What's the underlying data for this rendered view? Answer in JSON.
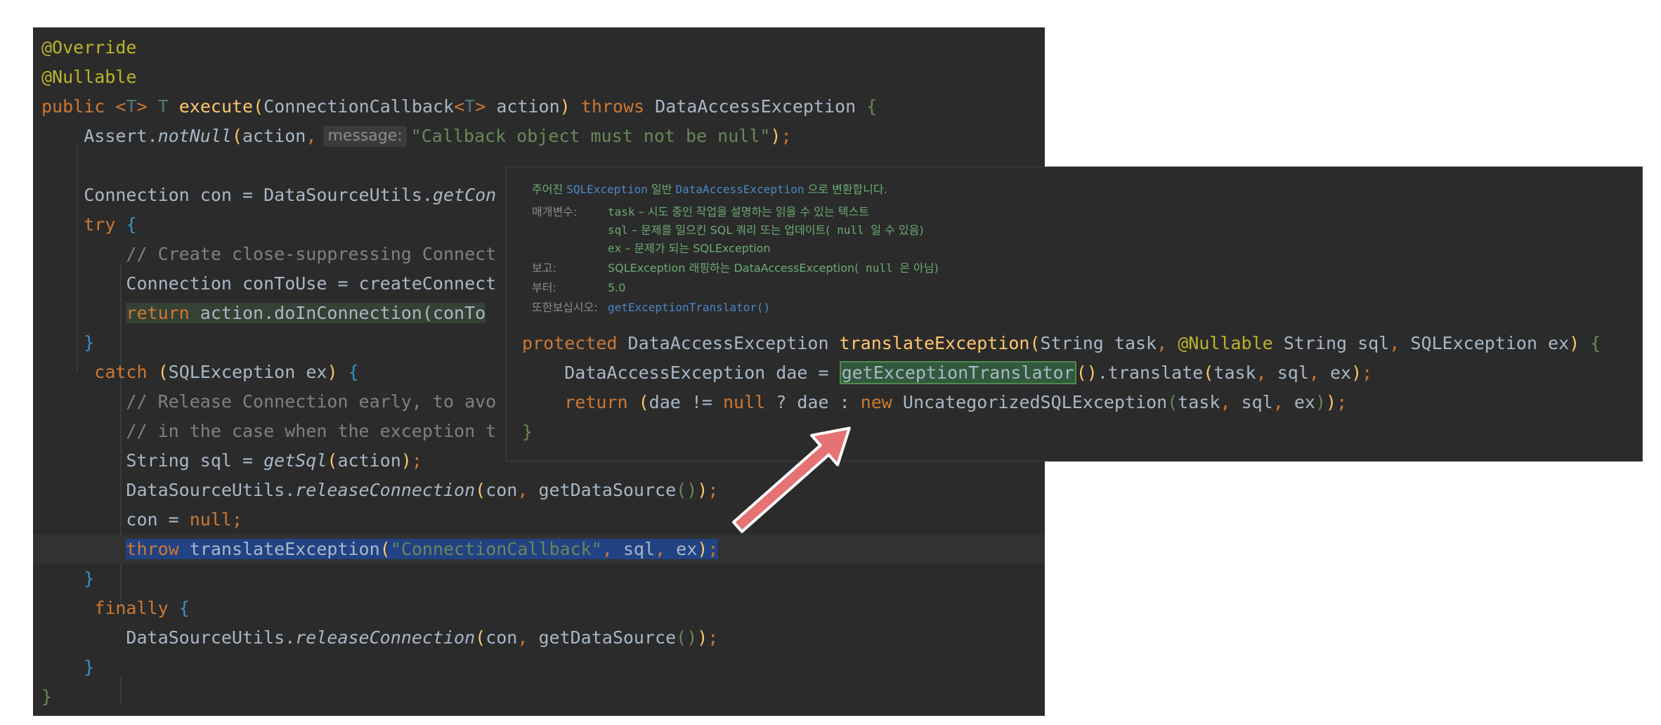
{
  "editor": {
    "override": "@Override",
    "nullable": "@Nullable",
    "sig": {
      "public": "public",
      "lt": "<",
      "T1": "T",
      "gt": ">",
      "T2": "T",
      "name": "execute",
      "open": "(",
      "type": "ConnectionCallback",
      "lt2": "<",
      "T3": "T",
      "gt2": ">",
      "param": " action",
      "close": ")",
      "throws": "throws",
      "exc": "DataAccessException",
      "brace": "{"
    },
    "l4": {
      "cls": "Assert.",
      "method": "notNull",
      "open": "(",
      "arg": "action",
      "comma": ",",
      "hint": "message:",
      "str": "\"Callback object must not be null\"",
      "close": ")",
      "semi": ";"
    },
    "l6": {
      "pre": "Connection con = DataSourceUtils.",
      "method": "getCon"
    },
    "l7": {
      "kw": "try",
      "brace": "{"
    },
    "l8": {
      "comment": "// Create close-suppressing Connect"
    },
    "l9": {
      "text": "Connection conToUse = createConnect"
    },
    "l10": {
      "kw": "return",
      "text": " action.doInConnection(conTo"
    },
    "l11": {
      "brace": "}"
    },
    "l12": {
      "kw": "catch",
      "open": "(",
      "text": "SQLException ex",
      "close": ")",
      "brace": "{"
    },
    "l13": {
      "comment": "// Release Connection early, to avo"
    },
    "l14": {
      "comment": "// in the case when the exception t"
    },
    "l15": {
      "pre": "String sql = ",
      "method": "getSql",
      "open": "(",
      "arg": "action",
      "close": ")",
      "semi": ";"
    },
    "l16": {
      "pre": "DataSourceUtils.",
      "method": "releaseConnection",
      "open": "(",
      "arg": "con",
      "comma": ",",
      "call": "getDataSource",
      "inner": "()",
      "close": ")",
      "semi": ";"
    },
    "l17": {
      "pre": "con = ",
      "kw": "null",
      "semi": ";"
    },
    "l18": {
      "kw": "throw",
      "name": " translateException",
      "open": "(",
      "str": "\"ConnectionCallback\"",
      "c1": ",",
      "a1": " sql",
      "c2": ",",
      "a2": " ex",
      "close": ")",
      "semi": ";"
    },
    "l19": {
      "brace": "}"
    },
    "l20": {
      "kw": "finally",
      "brace": "{"
    },
    "l21": {
      "pre": "DataSourceUtils.",
      "method": "releaseConnection",
      "open": "(",
      "arg": "con",
      "comma": ",",
      "call": "getDataSource",
      "inner": "()",
      "close": ")",
      "semi": ";"
    },
    "l22": {
      "brace": "}"
    },
    "l23": {
      "brace": "}"
    }
  },
  "popup": {
    "doc": {
      "summary_pre": "주어진 ",
      "summary_c1": "SQLException",
      "summary_mid": " 일반 ",
      "summary_c2": "DataAccessException",
      "summary_post": " 으로 변환합니다.",
      "params_label": "매개변수:",
      "p1_name": "task",
      "p1_desc": " – 시도 중인 작업을 설명하는 읽을 수 있는 텍스트",
      "p2_name": "sql",
      "p2_desc": " – 문제를 일으킨 SQL 쿼리 또는 업데이트(",
      "p2_null": " null ",
      "p2_post": "일 수 있음)",
      "p3_name": "ex",
      "p3_desc": " – 문제가 되는 SQLException",
      "returns_label": "보고:",
      "returns_text": "SQLException 래핑하는 DataAccessException(",
      "returns_null": " null ",
      "returns_post": "은 아님)",
      "since_label": "부터:",
      "since_value": "5.0",
      "see_label": "또한보십시오:",
      "see_link": "getExceptionTranslator()"
    },
    "code": {
      "l1": {
        "kw": "protected",
        "type": " DataAccessException ",
        "name": "translateException",
        "open": "(",
        "a": "String task",
        "c1": ",",
        "ann": " @Nullable",
        "b": " String sql",
        "c2": ",",
        "c": " SQLException ex",
        "close": ")",
        "brace": " {"
      },
      "l2": {
        "pre": "DataAccessException dae = ",
        "boxed": "getExceptionTranslator",
        "paren": "()",
        "post": ".translate",
        "open": "(",
        "a": "task",
        "c1": ",",
        "b": " sql",
        "c2": ",",
        "c": " ex",
        "close": ")",
        "semi": ";"
      },
      "l3": {
        "kw": "return",
        "o1": " (",
        "a": "dae != ",
        "n1": "null",
        "q": " ? dae : ",
        "nw": "new",
        "cls": " UncategorizedSQLException",
        "open": "(",
        "x": "task",
        "c1": ",",
        "y": " sql",
        "c2": ",",
        "z": " ex",
        "close": ")",
        "o2": ")",
        "semi": ";"
      },
      "l4": {
        "brace": "}"
      }
    }
  },
  "colors": {
    "arrow": "#e57373",
    "editor_bg": "#2b2b2b"
  }
}
